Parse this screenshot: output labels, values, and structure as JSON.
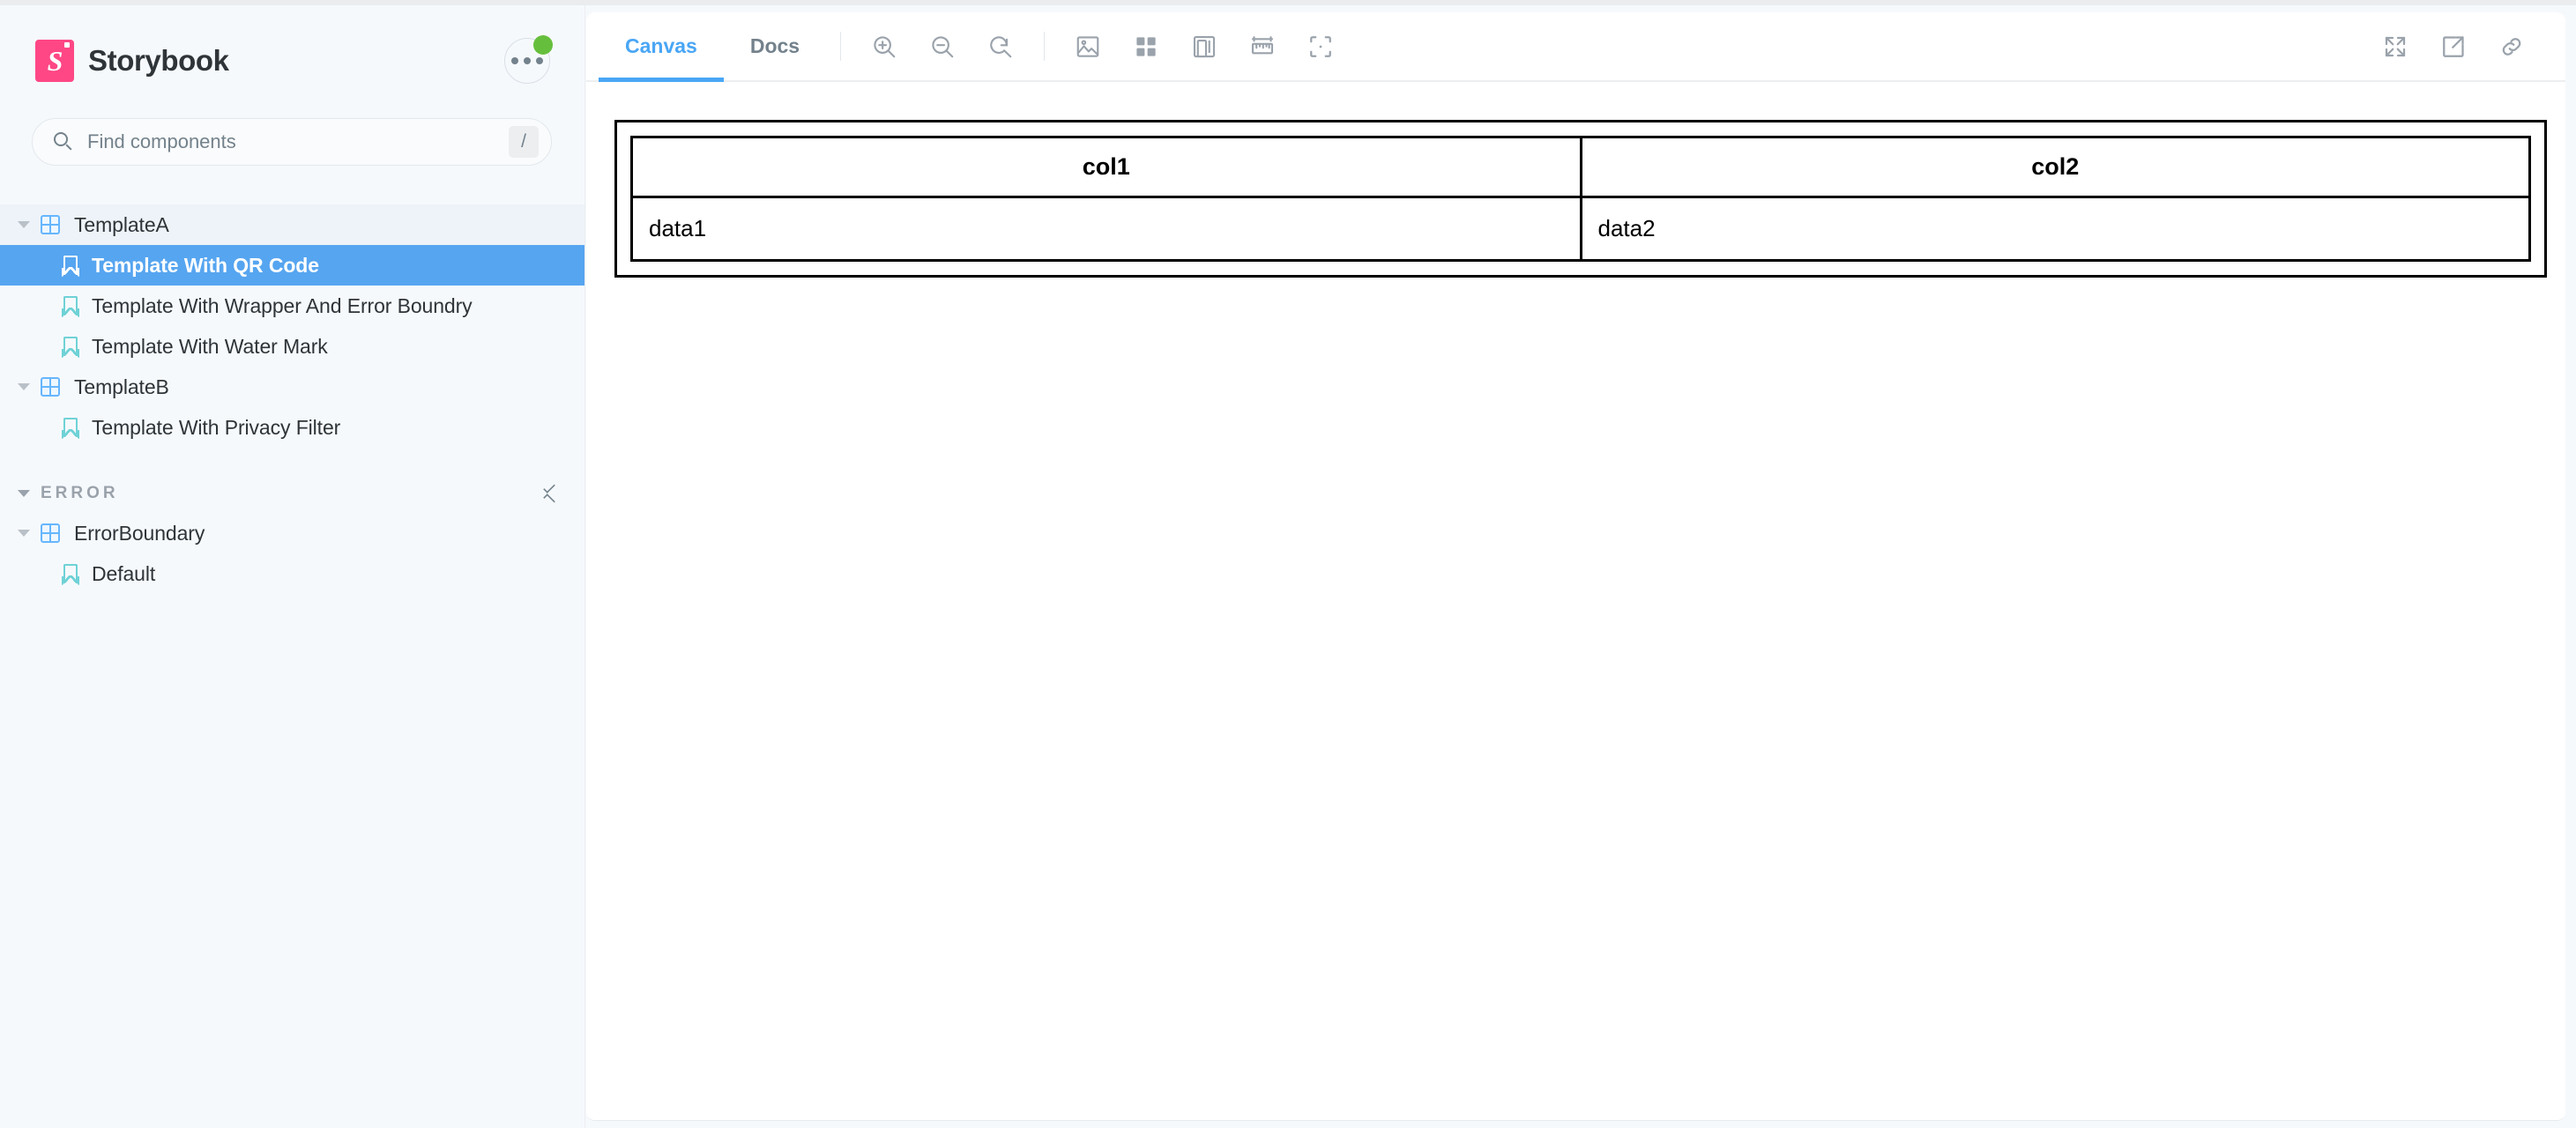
{
  "app": {
    "brand_name": "Storybook",
    "logo_letter": "S"
  },
  "sidebar": {
    "menu_button": {
      "name": "more-options",
      "has_badge": true,
      "badge_color": "#66bf3c"
    },
    "search": {
      "placeholder": "Find components",
      "value": "",
      "shortcut_key": "/"
    },
    "tree": [
      {
        "type": "component",
        "label": "TemplateA",
        "depth": 0,
        "expanded": true,
        "state": "active-parent"
      },
      {
        "type": "story",
        "label": "Template With QR Code",
        "depth": 1,
        "state": "selected"
      },
      {
        "type": "story",
        "label": "Template With Wrapper And Error Boundry",
        "depth": 1,
        "state": "normal"
      },
      {
        "type": "story",
        "label": "Template With Water Mark",
        "depth": 1,
        "state": "normal"
      },
      {
        "type": "component",
        "label": "TemplateB",
        "depth": 0,
        "expanded": true,
        "state": "normal"
      },
      {
        "type": "story",
        "label": "Template With Privacy Filter",
        "depth": 1,
        "state": "normal"
      }
    ],
    "group": {
      "title": "ERROR",
      "expanded": true,
      "collapse_all_label": "Collapse all",
      "items": [
        {
          "type": "component",
          "label": "ErrorBoundary",
          "depth": 0,
          "expanded": true,
          "state": "normal"
        },
        {
          "type": "story",
          "label": "Default",
          "depth": 1,
          "state": "normal"
        }
      ]
    }
  },
  "toolbar": {
    "tabs": [
      {
        "label": "Canvas",
        "active": true
      },
      {
        "label": "Docs",
        "active": false
      }
    ],
    "zoom_controls": [
      {
        "name": "zoom-in-icon",
        "title": "Zoom in"
      },
      {
        "name": "zoom-out-icon",
        "title": "Zoom out"
      },
      {
        "name": "zoom-reset-icon",
        "title": "Reset zoom"
      }
    ],
    "addon_controls": [
      {
        "name": "background-image-icon",
        "title": "Change background"
      },
      {
        "name": "grid-icon",
        "title": "Apply a grid to the preview"
      },
      {
        "name": "viewport-icon",
        "title": "Change the size of the preview"
      },
      {
        "name": "ruler-icon",
        "title": "Enable measure"
      },
      {
        "name": "outline-icon",
        "title": "Apply outlines to the preview"
      }
    ],
    "right_controls": [
      {
        "name": "fullscreen-icon",
        "title": "Go full screen"
      },
      {
        "name": "open-in-new-tab-icon",
        "title": "Open canvas in new tab"
      },
      {
        "name": "copy-link-icon",
        "title": "Copy canvas link"
      }
    ]
  },
  "preview": {
    "table": {
      "headers": [
        "col1",
        "col2"
      ],
      "rows": [
        [
          "data1",
          "data2"
        ]
      ]
    }
  },
  "colors": {
    "brand_pink": "#ff4785",
    "accent_blue": "#49a6f5",
    "selection_blue": "#56a5f0",
    "story_icon_teal": "#6fd2d6",
    "component_icon_blue": "#66b6ff",
    "badge_green": "#66bf3c",
    "sidebar_bg": "#f6f9fc",
    "panel_bg": "#ffffff",
    "muted_text": "#73828c"
  }
}
